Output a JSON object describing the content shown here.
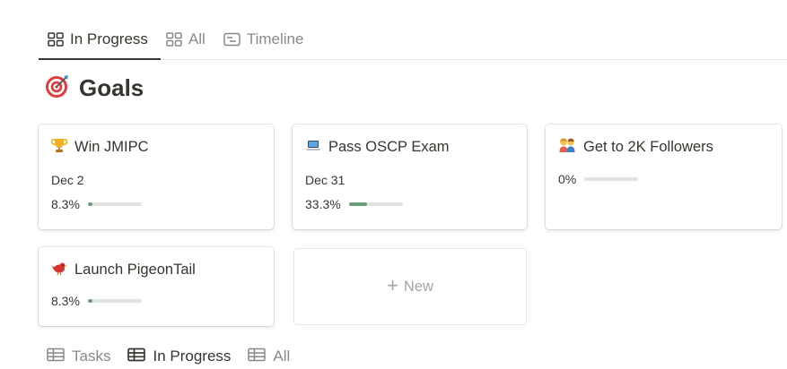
{
  "view_tabs": [
    {
      "label": "In Progress",
      "icon": "board-icon",
      "active": true
    },
    {
      "label": "All",
      "icon": "board-icon",
      "active": false
    },
    {
      "label": "Timeline",
      "icon": "timeline-icon",
      "active": false
    }
  ],
  "page": {
    "title": "Goals",
    "icon": "target-icon"
  },
  "cards": [
    {
      "title": "Win JMIPC",
      "icon": "trophy-icon",
      "date": "Dec 2",
      "progress_label": "8.3%",
      "progress": 0.083
    },
    {
      "title": "Pass OSCP Exam",
      "icon": "laptop-icon",
      "date": "Dec 31",
      "progress_label": "33.3%",
      "progress": 0.333
    },
    {
      "title": "Get to 2K Followers",
      "icon": "people-icon",
      "progress_label": "0%",
      "progress": 0
    },
    {
      "title": "Launch PigeonTail",
      "icon": "bird-icon",
      "progress_label": "8.3%",
      "progress": 0.083
    }
  ],
  "new_card": {
    "label": "New",
    "icon": "plus-icon"
  },
  "bottom_tabs": [
    {
      "label": "Tasks",
      "icon": "table-icon",
      "active": false
    },
    {
      "label": "In Progress",
      "icon": "table-icon",
      "active": true
    },
    {
      "label": "All",
      "icon": "table-icon",
      "active": false
    }
  ],
  "colors": {
    "progress_fill": "#6c9b7d",
    "progress_track": "#e3e3e1",
    "text": "#37352f",
    "muted": "#8a8985"
  }
}
